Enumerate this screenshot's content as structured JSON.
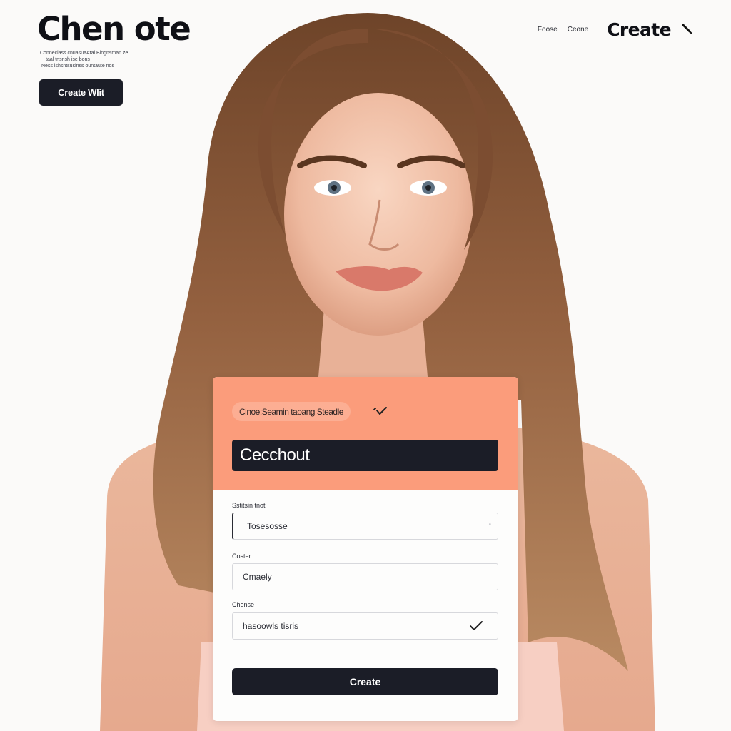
{
  "header": {
    "brand": "Chen ote",
    "tagline": [
      "Conneclass cnuasuaAtal Bingnsman ze",
      "taal tnsnsh ise bons",
      "Ness ishsntsusinss ountaute nos"
    ],
    "cta_label": "Create Wlit",
    "nav": [
      "Foose",
      "Ceone"
    ],
    "nav_create": "Create",
    "nav_icon": "pen-icon"
  },
  "card": {
    "chip_label": "Cinoe:Seamin taoang Steadle",
    "chip_icon": "check-icon",
    "header_field_value": "Cecchout",
    "fields": [
      {
        "label": "Sstitsin tnot",
        "value": "Tosesosse"
      },
      {
        "label": "Coster",
        "value": "Cmaely"
      },
      {
        "label": "Chense",
        "value": "hasoowls tisris",
        "icon": "check-icon"
      }
    ],
    "submit_label": "Create"
  },
  "colors": {
    "card_accent": "#fb9c7b",
    "button_dark": "#1b1d27",
    "hair": "#8a5a3b",
    "skin": "#f1c3aa"
  }
}
